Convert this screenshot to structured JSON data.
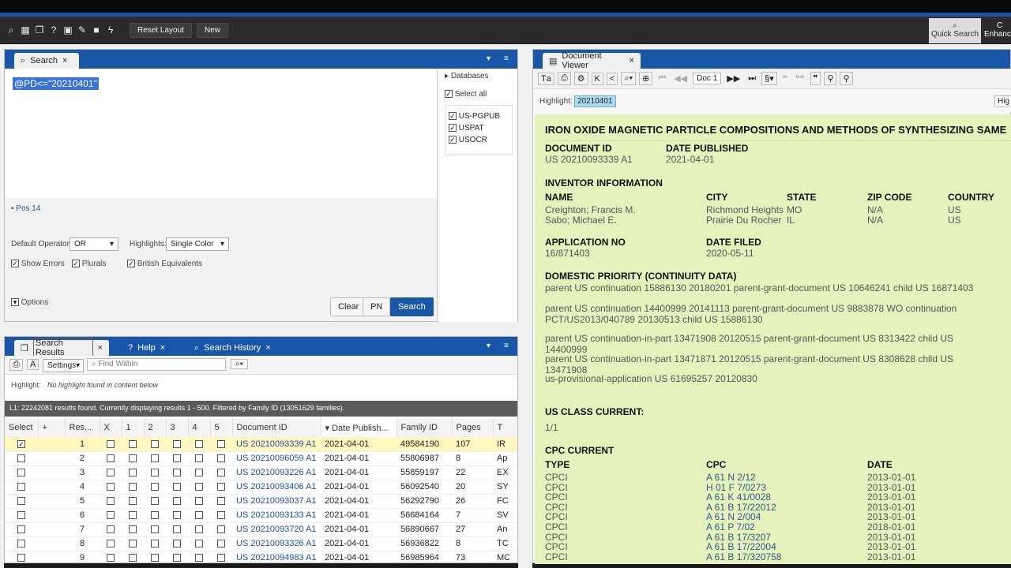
{
  "toolbar": {
    "reset": "Reset Layout",
    "new": "New",
    "quick": "Quick Search",
    "enhance": "Enhanc"
  },
  "search": {
    "tab": "Search",
    "query": "@PD<=\"20210401\"",
    "pos": "Pos 14",
    "db_label": "Databases",
    "select_all": "Select all",
    "dbs": [
      "US-PGPUB",
      "USPAT",
      "USOCR"
    ],
    "op_label": "Default Operator:",
    "op_value": "OR",
    "hl_label": "Highlights:",
    "hl_value": "Single Color",
    "show_errors": "Show Errors",
    "plurals": "Plurals",
    "british": "British Equivalents",
    "options": "Options",
    "clear": "Clear",
    "pn": "PN",
    "search_btn": "Search"
  },
  "results": {
    "tabs": [
      "Search Results",
      "Help",
      "Search History"
    ],
    "settings": "Settings",
    "find_placeholder": "Find Within",
    "highlight_label": "Highlight:",
    "highlight_msg": "No highlight found in content below",
    "status": "L1: 22242081 results found. Currently displaying results 1 - 500. Filtered by Family ID (13051629 families).",
    "columns": [
      "Select",
      "+",
      "Res...",
      "X",
      "1",
      "2",
      "3",
      "4",
      "5",
      "Document ID",
      "Date Publish...",
      "Family ID",
      "Pages",
      "T"
    ],
    "rows": [
      [
        "1",
        "US 20210093339 A1",
        "2021-04-01",
        "49584190",
        "107",
        "IR"
      ],
      [
        "2",
        "US 20210096059 A1",
        "2021-04-01",
        "55806987",
        "8",
        "Ap"
      ],
      [
        "3",
        "US 20210093226 A1",
        "2021-04-01",
        "55859197",
        "22",
        "EX"
      ],
      [
        "4",
        "US 20210093406 A1",
        "2021-04-01",
        "56092540",
        "20",
        "SY"
      ],
      [
        "5",
        "US 20210093037 A1",
        "2021-04-01",
        "56292790",
        "26",
        "FC"
      ],
      [
        "6",
        "US 20210093133 A1",
        "2021-04-01",
        "56684164",
        "7",
        "SV"
      ],
      [
        "7",
        "US 20210093720 A1",
        "2021-04-01",
        "56890667",
        "27",
        "An"
      ],
      [
        "8",
        "US 20210093326 A1",
        "2021-04-01",
        "56936822",
        "8",
        "TC"
      ],
      [
        "9",
        "US 20210094983 A1",
        "2021-04-01",
        "56985964",
        "73",
        "MC"
      ]
    ]
  },
  "viewer": {
    "tab": "Document Viewer",
    "doc": "Doc 1",
    "highlight_label": "Highlight:",
    "highlight_value": "20210401",
    "hig": "Hig",
    "title": "IRON OXIDE MAGNETIC PARTICLE COMPOSITIONS AND METHODS OF SYNTHESIZING SAME",
    "docid_label": "DOCUMENT ID",
    "docid": "US 20210093339 A1",
    "datepub_label": "DATE PUBLISHED",
    "datepub": "2021-04-01",
    "inv_label": "INVENTOR INFORMATION",
    "inv_cols": [
      "NAME",
      "CITY",
      "STATE",
      "ZIP CODE",
      "COUNTRY"
    ],
    "inventors": [
      [
        "Creighton; Francis M.",
        "Richmond Heights",
        "MO",
        "N/A",
        "US"
      ],
      [
        "Sabo; Michael E.",
        "Prairie Du Rocher",
        "IL",
        "N/A",
        "US"
      ]
    ],
    "appno_label": "APPLICATION NO",
    "appno": "16/871403",
    "filed_label": "DATE FILED",
    "filed": "2020-05-11",
    "dp_label": "DOMESTIC PRIORITY (CONTINUITY DATA)",
    "dp": [
      "parent US continuation 15886130 20180201 parent-grant-document US 10646241 child US 16871403",
      "parent US continuation 14400999 20141113 parent-grant-document US 9883878 WO continuation PCT/US2013/040789 20130513 child US 15886130",
      "parent US continuation-in-part 13471908 20120515 parent-grant-document US 8313422 child US 14400999",
      "parent US continuation-in-part 13471871 20120515 parent-grant-document US 8308628 child US 13471908",
      "us-provisional-application US 61695257 20120830"
    ],
    "usclass_label": "US CLASS CURRENT:",
    "usclass": "1/1",
    "cpc_label": "CPC CURRENT",
    "cpc_cols": [
      "TYPE",
      "CPC",
      "DATE"
    ],
    "cpc": [
      [
        "CPCI",
        "A 61 N 2/12",
        "2013-01-01"
      ],
      [
        "CPCI",
        "H 01 F 7/0273",
        "2013-01-01"
      ],
      [
        "CPCI",
        "A 61 K 41/0028",
        "2013-01-01"
      ],
      [
        "CPCI",
        "A 61 B 17/22012",
        "2013-01-01"
      ],
      [
        "CPCI",
        "A 61 N 2/004",
        "2013-01-01"
      ],
      [
        "CPCI",
        "A 61 P 7/02",
        "2018-01-01"
      ],
      [
        "CPCI",
        "A 61 B 17/3207",
        "2013-01-01"
      ],
      [
        "CPCI",
        "A 61 B 17/22004",
        "2013-01-01"
      ],
      [
        "CPCI",
        "A 61 B 17/320758",
        "2013-01-01"
      ]
    ]
  }
}
